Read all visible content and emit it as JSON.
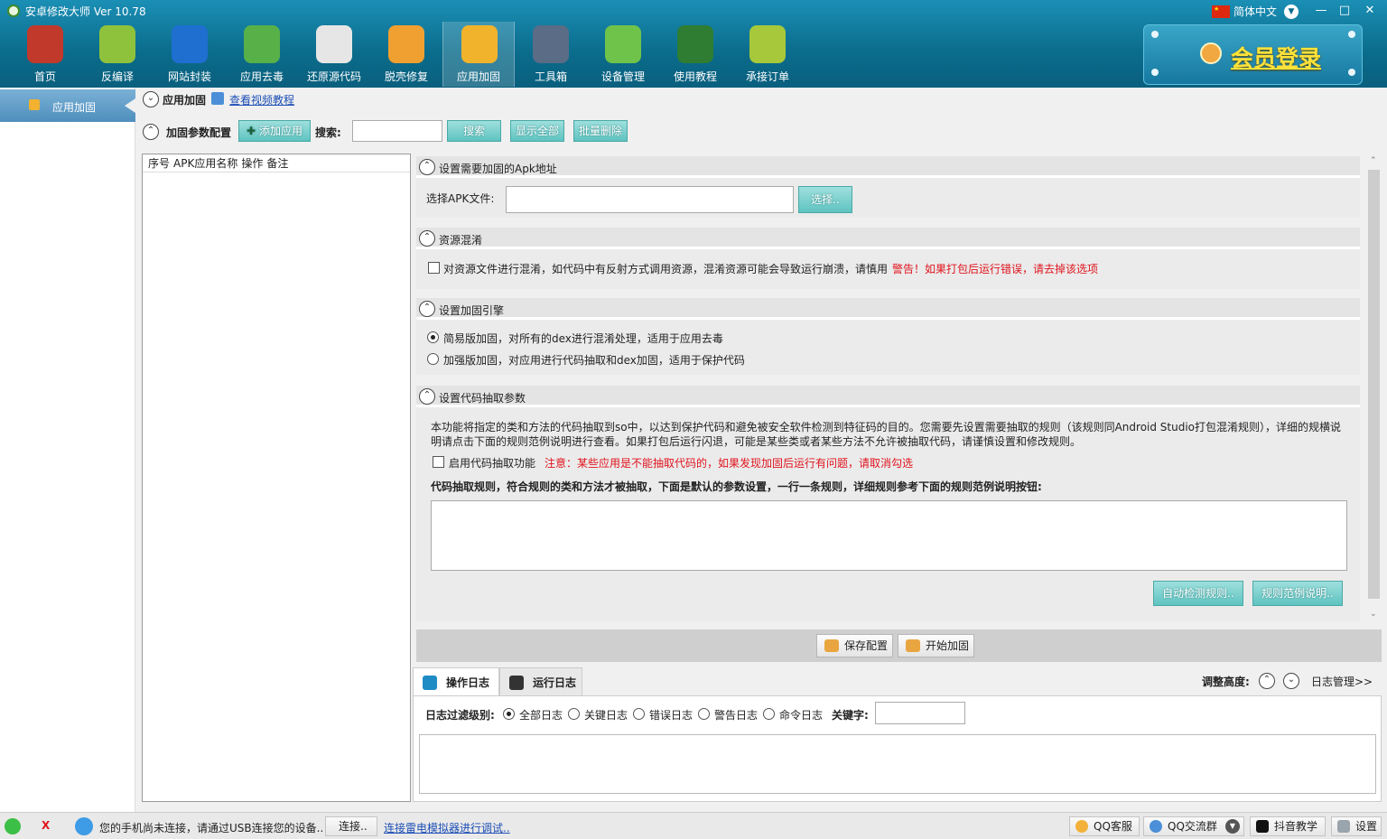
{
  "window": {
    "title": "安卓修改大师 Ver 10.78",
    "language": "简体中文",
    "minimize": "—",
    "maximize": "□",
    "close": "✕"
  },
  "toolbar": {
    "items": [
      {
        "label": "首页",
        "icon": "home-icon",
        "color": "#c0392b"
      },
      {
        "label": "反编译",
        "icon": "android-icon",
        "color": "#8fc23c"
      },
      {
        "label": "网站封装",
        "icon": "ie-icon",
        "color": "#1e6fd0"
      },
      {
        "label": "应用去毒",
        "icon": "shield-icon",
        "color": "#58b048"
      },
      {
        "label": "还原源代码",
        "icon": "document-icon",
        "color": "#e6e6e6"
      },
      {
        "label": "脱壳修复",
        "icon": "windows-orb-icon",
        "color": "#f0a030"
      },
      {
        "label": "应用加固",
        "icon": "lock-icon",
        "color": "#f2b32c"
      },
      {
        "label": "工具箱",
        "icon": "toolbox-icon",
        "color": "#5a6c86"
      },
      {
        "label": "设备管理",
        "icon": "radar-icon",
        "color": "#6fc34a"
      },
      {
        "label": "使用教程",
        "icon": "chalkboard-icon",
        "color": "#2e7d32"
      },
      {
        "label": "承接订单",
        "icon": "order-bag-icon",
        "color": "#a6c83a"
      }
    ],
    "active_index": 6
  },
  "member": {
    "label": "会员登录"
  },
  "sidebar": {
    "item": "应用加固"
  },
  "breadcrumb": {
    "title": "应用加固",
    "help_link": "查看视频教程"
  },
  "config_bar": {
    "label": "加固参数配置",
    "add_button": "添加应用",
    "search_label": "搜索:",
    "search_value": "",
    "search_button": "搜索",
    "show_all_button": "显示全部",
    "batch_delete_button": "批量删除"
  },
  "apk_list": {
    "columns": [
      "序号",
      "APK应用名称",
      "操作",
      "备注"
    ]
  },
  "section_apk": {
    "title": "设置需要加固的Apk地址",
    "file_label": "选择APK文件:",
    "file_value": "",
    "choose_button": "选择.."
  },
  "section_obfuscate": {
    "title": "资源混淆",
    "option_text": "对资源文件进行混淆，如代码中有反射方式调用资源，混淆资源可能会导致运行崩溃，请慎用",
    "warning": "警告！如果打包后运行错误，请去掉该选项"
  },
  "section_engine": {
    "title": "设置加固引擎",
    "option_simple": "简易版加固，对所有的dex进行混淆处理，适用于应用去毒",
    "option_enhanced": "加强版加固，对应用进行代码抽取和dex加固，适用于保护代码"
  },
  "section_extract": {
    "title": "设置代码抽取参数",
    "desc_line1": "本功能将指定的类和方法的代码抽取到so中，以达到保护代码和避免被安全软件检测到特征码的目的。您需要先设置需要抽取的规则（该规则同Android Studio打包混淆规则），详细的规横说",
    "desc_line2": "明请点击下面的规则范例说明进行查看。如果打包后运行闪退，可能是某些类或者某些方法不允许被抽取代码，请谨慎设置和修改规则。",
    "enable_label": "启用代码抽取功能",
    "enable_note": "注意：某些应用是不能抽取代码的，如果发现加固后运行有问题，请取消勾选",
    "rules_label": "代码抽取规则，符合规则的类和方法才被抽取，下面是默认的参数设置，一行一条规则，详细规则参考下面的规则范例说明按钮:",
    "rules_value": "",
    "detect_button": "自动检测规则..",
    "example_button": "规则范例说明.."
  },
  "actions": {
    "save": "保存配置",
    "start": "开始加固"
  },
  "log": {
    "tab_ops": "操作日志",
    "tab_run": "运行日志",
    "adjust_label": "调整高度:",
    "manage_link": "日志管理>>",
    "filter_label": "日志过滤级别:",
    "levels": [
      "全部日志",
      "关键日志",
      "错误日志",
      "警告日志",
      "命令日志"
    ],
    "keyword_label": "关键字:",
    "keyword_value": ""
  },
  "status": {
    "message": "您的手机尚未连接，请通过USB连接您的设备..",
    "connect_button": "连接..",
    "emulator_link": "连接雷电模拟器进行调试..",
    "qq_service": "QQ客服",
    "qq_group": "QQ交流群",
    "douyin": "抖音教学",
    "settings": "设置",
    "x_mark": "X"
  }
}
